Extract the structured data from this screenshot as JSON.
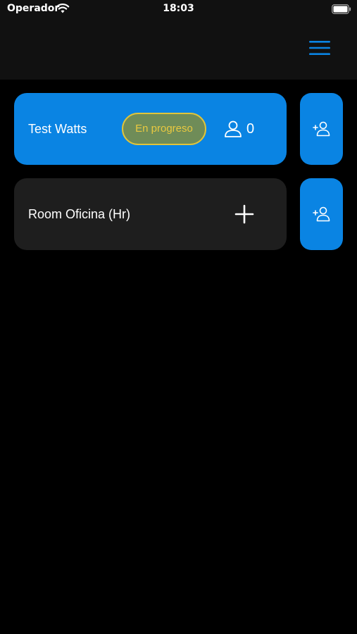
{
  "status_bar": {
    "carrier": "Operador",
    "time": "18:03"
  },
  "header": {
    "menu_icon": "hamburger-menu-icon",
    "accent_color": "#0a84e3"
  },
  "rooms": [
    {
      "name": "Test Watts",
      "state": "active",
      "status_label": "En progreso",
      "participants": "0",
      "participant_icon": "person-icon",
      "invite_icon": "add-person-icon"
    },
    {
      "name": "Room Oficina (Hr)",
      "state": "inactive",
      "action_icon": "plus-icon",
      "invite_icon": "add-person-icon"
    }
  ],
  "colors": {
    "card_active": "#0a84e3",
    "card_inactive": "#1e1e1e",
    "badge_border": "#e0c43a",
    "badge_text": "#e9c940",
    "background": "#000000"
  }
}
